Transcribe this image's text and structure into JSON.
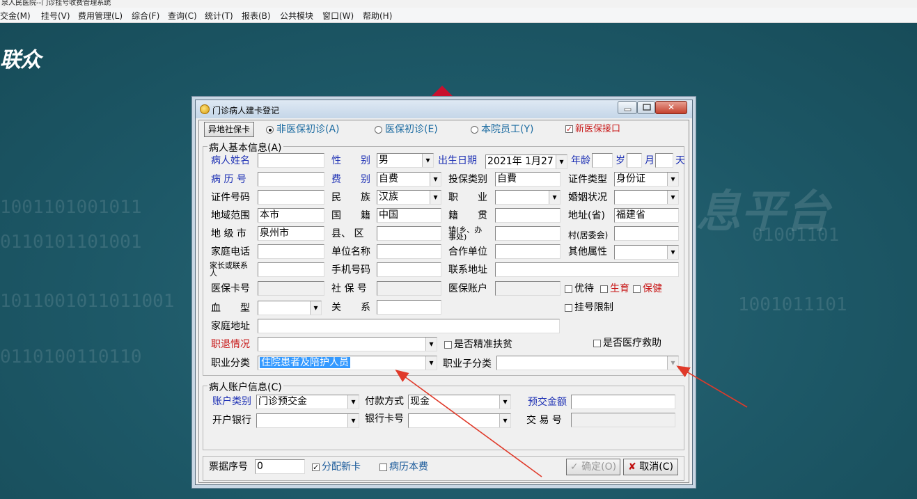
{
  "window": {
    "title": "泉人民医院--门诊挂号收费管理系统"
  },
  "menu": [
    "交金(M)",
    "挂号(V)",
    "费用管理(L)",
    "综合(F)",
    "查询(C)",
    "统计(T)",
    "报表(B)",
    "公共模块",
    "窗口(W)",
    "帮助(H)"
  ],
  "desktop": {
    "logo": "联众"
  },
  "dialog": {
    "title": "门诊病人建卡登记",
    "close_glyph": "✕",
    "top": {
      "offsite_button": "异地社保卡",
      "radio_non_insured": "非医保初诊(A)",
      "radio_insured": "医保初诊(E)",
      "radio_staff": "本院员工(Y)",
      "new_interface_label": "新医保接口"
    },
    "basic": {
      "group_title": "病人基本信息(A)",
      "name_label": "病人姓名",
      "name_value": "",
      "sex_label": "性　　别",
      "sex_value": "男",
      "birth_label": "出生日期",
      "birth_value": "2021年 1月27",
      "age_label": "年龄",
      "age_year_unit": "岁",
      "age_month_unit": "月",
      "age_day_unit": "天",
      "record_label": "病 历 号",
      "record_value": "",
      "fee_label": "费　　别",
      "fee_value": "自费",
      "ins_type_label": "投保类别",
      "ins_type_value": "自費",
      "id_type_label": "证件类型",
      "id_type_value": "身份证",
      "id_no_label": "证件号码",
      "id_no_value": "",
      "ethnic_label": "民　　族",
      "ethnic_value": "汉族",
      "job_label": "职　　业",
      "job_value": "",
      "marriage_label": "婚姻状况",
      "marriage_value": "",
      "region_label": "地域范围",
      "region_value": "本市",
      "nation_label": "国　　籍",
      "nation_value": "中国",
      "native_label": "籍　　贯",
      "native_value": "",
      "province_label": "地址(省)",
      "province_value": "福建省",
      "city_label": "地 级 市",
      "city_value": "泉州市",
      "county_label": "县、 区",
      "county_value": "",
      "town_label_1": "镇(乡、办",
      "town_label_2": "事处)",
      "town_value": "",
      "village_label": "村(居委会)",
      "village_value": "",
      "home_phone_label": "家庭电话",
      "home_phone_value": "",
      "employer_label": "单位名称",
      "employer_value": "",
      "partner_label": "合作单位",
      "partner_value": "",
      "other_attr_label": "其他属性",
      "other_attr_value": "",
      "guardian_label_1": "家长或联系",
      "guardian_label_2": "人",
      "guardian_value": "",
      "mobile_label": "手机号码",
      "mobile_value": "",
      "contact_addr_label": "联系地址",
      "contact_addr_value": "",
      "insurance_card_label": "医保卡号",
      "insurance_card_value": "",
      "social_no_label": "社 保 号",
      "social_no_value": "",
      "insurance_account_label": "医保账户",
      "insurance_account_value": "",
      "preferential_label": "优待",
      "maternity_label": "生育",
      "healthcare_label": "保健",
      "blood_label": "血　　型",
      "blood_value": "",
      "relation_label": "关　　系",
      "relation_value": "",
      "limit_label": "挂号限制",
      "home_addr_label": "家庭地址",
      "home_addr_value": "",
      "retire_label": "职退情况",
      "retire_value": "",
      "poverty_label": "是否精准扶贫",
      "medical_aid_label": "是否医疗救助",
      "occupation_label": "职业分类",
      "occupation_value": "住院患者及陪护人员",
      "sub_occupation_label": "职业子分类",
      "sub_occupation_value": ""
    },
    "account": {
      "group_title": "病人账户信息(C)",
      "type_label": "账户类别",
      "type_value": "门诊预交金",
      "pay_label": "付款方式",
      "pay_value": "现金",
      "prepay_label": "预交金额",
      "prepay_value": "",
      "bank_label": "开户银行",
      "bank_value": "",
      "bank_card_label": "银行卡号",
      "bank_card_value": "",
      "trade_label": "交 易 号",
      "trade_value": ""
    },
    "bottom": {
      "receipt_label": "票据序号",
      "receipt_value": "0",
      "assign_card_label": "分配新卡",
      "assign_card_checked": true,
      "record_fee_label": "病历本费",
      "record_fee_checked": false,
      "ok_button": "确定(O)",
      "ok_icon": "✓",
      "cancel_button": "取消(C)",
      "cancel_icon": "✘"
    }
  }
}
